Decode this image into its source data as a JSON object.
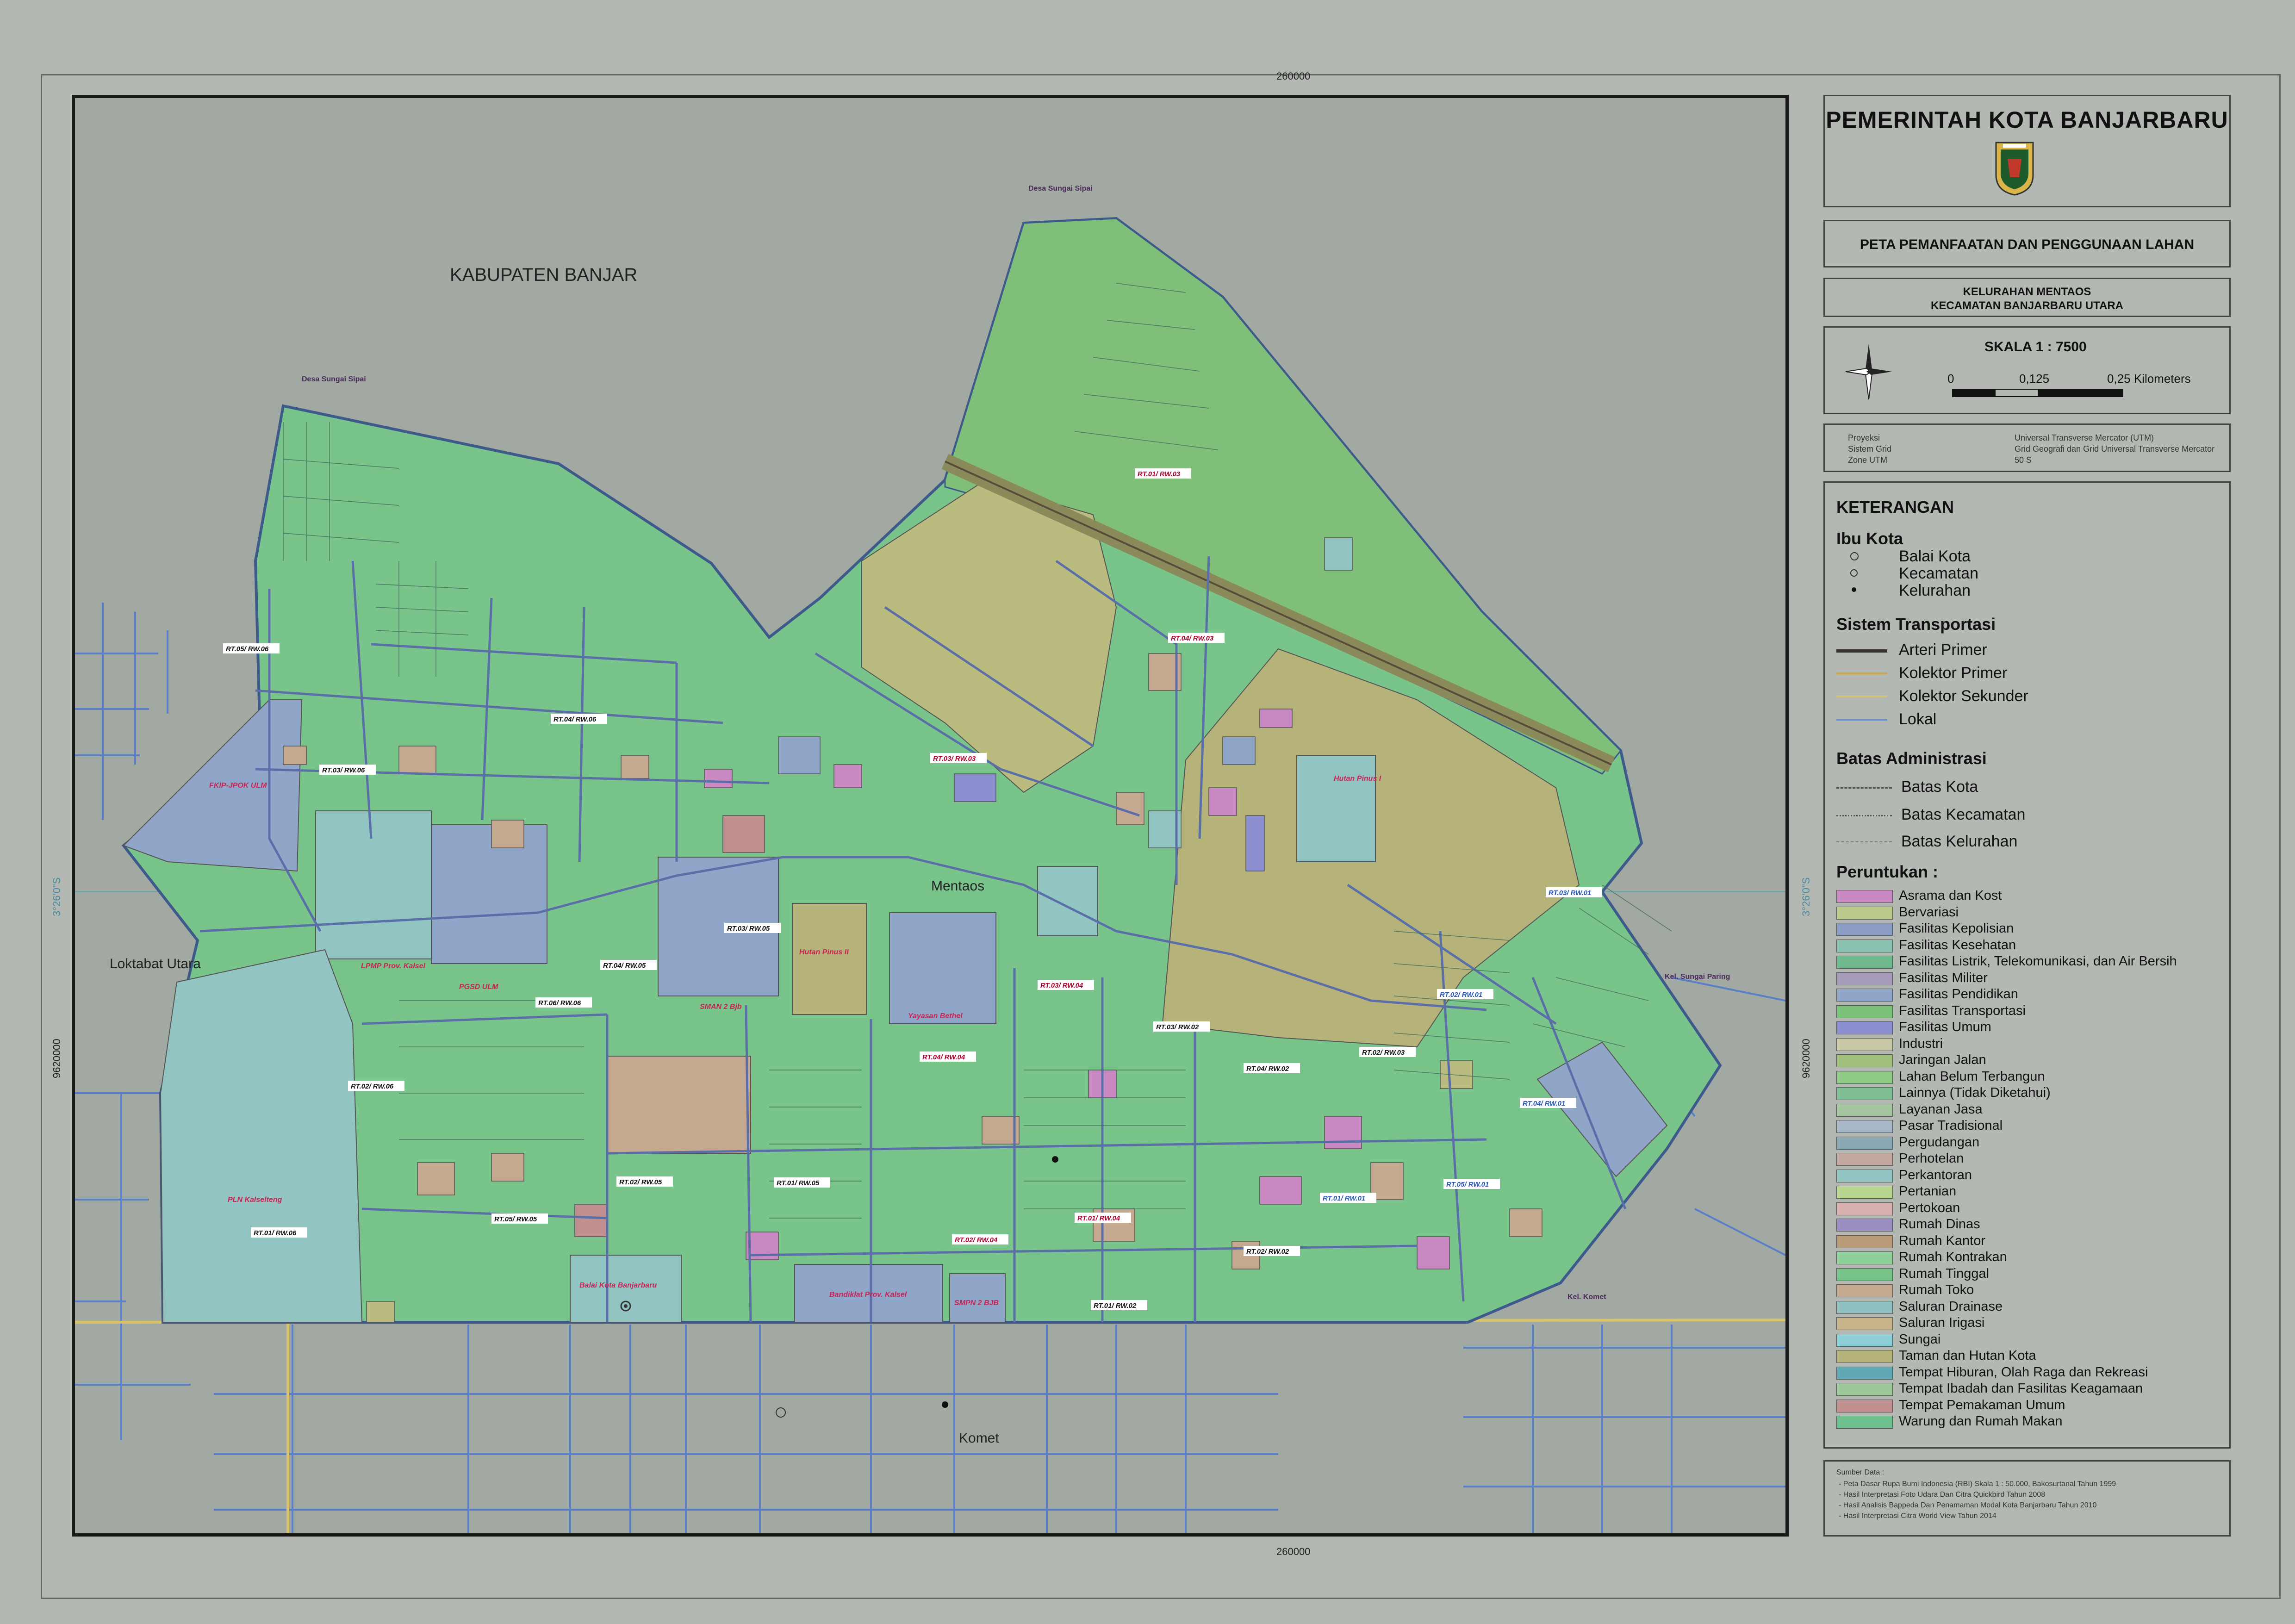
{
  "coords": {
    "top_easting": "260000",
    "bottom_easting": "260000",
    "left_northing": "9620000",
    "right_northing": "9620000",
    "left_lat": "3°26'0\"S",
    "right_lat": "3°26'0\"S"
  },
  "map_labels": {
    "kabupaten": "KABUPATEN BANJAR",
    "desa_sungai_sipai_top": "Desa Sungai Sipai",
    "desa_sungai_sipai_left": "Desa Sungai Sipai",
    "loktabat": "Loktabat Utara",
    "mentaos": "Mentaos",
    "komet": "Komet",
    "kel_sungai_paring": "Kel. Sungai Paring",
    "kel_komet": "Kel. Komet",
    "hutan_pinus_1": "Hutan Pinus I",
    "hutan_pinus_2": "Hutan Pinus II",
    "fkip": "FKIP-JPOK ULM",
    "lpmp": "LPMP Prov. Kalsel",
    "pgsd": "PGSD ULM",
    "sman2": "SMAN 2 Bjb",
    "yayasan": "Yayasan Bethel",
    "pln": "PLN Kalselteng",
    "balai": "Balai Kota Banjarbaru",
    "bandiklat": "Bandiklat Prov. Kalsel",
    "smpn2": "SMPN 2 BJB"
  },
  "rtrw": [
    "RT.01/ RW.03",
    "RT.04/ RW.03",
    "RT.05/ RW.06",
    "RT.04/ RW.06",
    "RT.03/ RW.06",
    "RT.03/ RW.03",
    "RT.03/ RW.05",
    "RT.04/ RW.05",
    "RT.06/ RW.06",
    "RT.02/ RW.06",
    "RT.01/ RW.06",
    "RT.05/ RW.05",
    "RT.02/ RW.05",
    "RT.01/ RW.05",
    "RT.03/ RW.04",
    "RT.04/ RW.04",
    "RT.02/ RW.04",
    "RT.01/ RW.04",
    "RT.01/ RW.02",
    "RT.02/ RW.02",
    "RT.03/ RW.02",
    "RT.04/ RW.02",
    "RT.02/ RW.03",
    "RT.02/ RW.01",
    "RT.03/ RW.01",
    "RT.04/ RW.01",
    "RT.05/ RW.01",
    "RT.01/ RW.01"
  ],
  "header": {
    "title": "PEMERINTAH KOTA BANJARBARU",
    "map_title": "PETA PEMANFAATAN DAN PENGGUNAAN LAHAN",
    "kelurahan": "KELURAHAN MENTAOS",
    "kecamatan": "KECAMATAN BANJARBARU UTARA"
  },
  "scale": {
    "label": "SKALA  1 : 7500",
    "tick0": "0",
    "tick1": "0,125",
    "tick2": "0,25 Kilometers"
  },
  "projection": {
    "l1": "Proyeksi",
    "v1": "Universal Transverse Mercator (UTM)",
    "l2": "Sistem Grid",
    "v2": "Grid Geografi dan Grid Universal Transverse Mercator",
    "l3": "Zone UTM",
    "v3": "50 S"
  },
  "legend": {
    "heading": "KETERANGAN",
    "ibukota": "Ibu Kota",
    "balai": "Balai Kota",
    "kecamatan": "Kecamatan",
    "kelurahan": "Kelurahan",
    "transport": "Sistem Transportasi",
    "arteri": "Arteri Primer",
    "kolektor_p": "Kolektor Primer",
    "kolektor_s": "Kolektor Sekunder",
    "lokal": "Lokal",
    "batas": "Batas Administrasi",
    "batas_kota": "Batas Kota",
    "batas_kec": "Batas Kecamatan",
    "batas_kel": "Batas Kelurahan",
    "peruntukan": "Peruntukan :",
    "items": [
      {
        "label": "Asrama dan Kost",
        "color": "#c98ac4"
      },
      {
        "label": "Bervariasi",
        "color": "#b9c98a"
      },
      {
        "label": "Fasilitas Kepolisian",
        "color": "#8a9cc2"
      },
      {
        "label": "Fasilitas Kesehatan",
        "color": "#8ac0b0"
      },
      {
        "label": "Fasilitas Listrik, Telekomunikasi, dan Air Bersih",
        "color": "#6fb98f"
      },
      {
        "label": "Fasilitas Militer",
        "color": "#a59ab8"
      },
      {
        "label": "Fasilitas Pendidikan",
        "color": "#90a6c8"
      },
      {
        "label": "Fasilitas Transportasi",
        "color": "#7bc27b"
      },
      {
        "label": "Fasilitas Umum",
        "color": "#8b8fcf"
      },
      {
        "label": "Industri",
        "color": "#c9c9a8"
      },
      {
        "label": "Jaringan Jalan",
        "color": "#9fbf7a"
      },
      {
        "label": "Lahan Belum Terbangun",
        "color": "#8fca86"
      },
      {
        "label": "Lainnya (Tidak Diketahui)",
        "color": "#7fbf93"
      },
      {
        "label": "Layanan Jasa",
        "color": "#a5c5a0"
      },
      {
        "label": "Pasar Tradisional",
        "color": "#a8b8c8"
      },
      {
        "label": "Pergudangan",
        "color": "#8aa8b4"
      },
      {
        "label": "Perhotelan",
        "color": "#c2a8a0"
      },
      {
        "label": "Perkantoran",
        "color": "#92c4c2"
      },
      {
        "label": "Pertanian",
        "color": "#b8d690"
      },
      {
        "label": "Pertokoan",
        "color": "#d8b0b0"
      },
      {
        "label": "Rumah Dinas",
        "color": "#9a8fc0"
      },
      {
        "label": "Rumah Kantor",
        "color": "#b89a78"
      },
      {
        "label": "Rumah Kontrakan",
        "color": "#8fcf9a"
      },
      {
        "label": "Rumah Tinggal",
        "color": "#79c48b"
      },
      {
        "label": "Rumah Toko",
        "color": "#c4a88f"
      },
      {
        "label": "Saluran Drainase",
        "color": "#8fbfbf"
      },
      {
        "label": "Saluran Irigasi",
        "color": "#c8b48a"
      },
      {
        "label": "Sungai",
        "color": "#8ccfd6"
      },
      {
        "label": "Taman dan Hutan Kota",
        "color": "#b5b37a"
      },
      {
        "label": "Tempat Hiburan, Olah Raga dan Rekreasi",
        "color": "#5fa8b4"
      },
      {
        "label": "Tempat Ibadah dan Fasilitas Keagamaan",
        "color": "#9cc89a"
      },
      {
        "label": "Tempat Pemakaman Umum",
        "color": "#c08f8f"
      },
      {
        "label": "Warung dan Rumah Makan",
        "color": "#6fc08f"
      }
    ]
  },
  "sources": {
    "title": "Sumber Data :",
    "s1": "- Peta Dasar Rupa Bumi Indonesia (RBI) Skala 1 : 50.000, Bakosurtanal Tahun 1999",
    "s2": "- Hasil Interpretasi Foto Udara Dan Citra Quickbird Tahun 2008",
    "s3": "- Hasil Analisis Bappeda Dan Penamaman Modal Kota Banjarbaru Tahun 2010",
    "s4": "- Hasil Interpretasi Citra World View Tahun 2014"
  },
  "colors": {
    "residential": "#79c48b",
    "forest": "#b5b37a",
    "education": "#90a6c8",
    "office": "#92c4c2",
    "green_area": "#7fbf7a",
    "road": "#5a6fa8",
    "background": "#a2a9a2"
  }
}
